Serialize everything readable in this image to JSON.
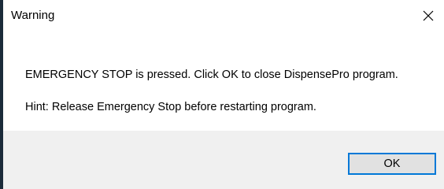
{
  "window": {
    "title": "Warning",
    "close_icon": "close-icon"
  },
  "message": {
    "line1": "EMERGENCY STOP is pressed. Click OK to close DispensePro program.",
    "line2": "Hint: Release Emergency Stop before restarting program."
  },
  "buttons": {
    "ok_label": "OK"
  },
  "colors": {
    "window_bg": "#ffffff",
    "footer_bg": "#f0f0f0",
    "button_bg": "#e1e1e1",
    "button_border_focus": "#0078d7",
    "left_edge": "#1b2b3a"
  }
}
